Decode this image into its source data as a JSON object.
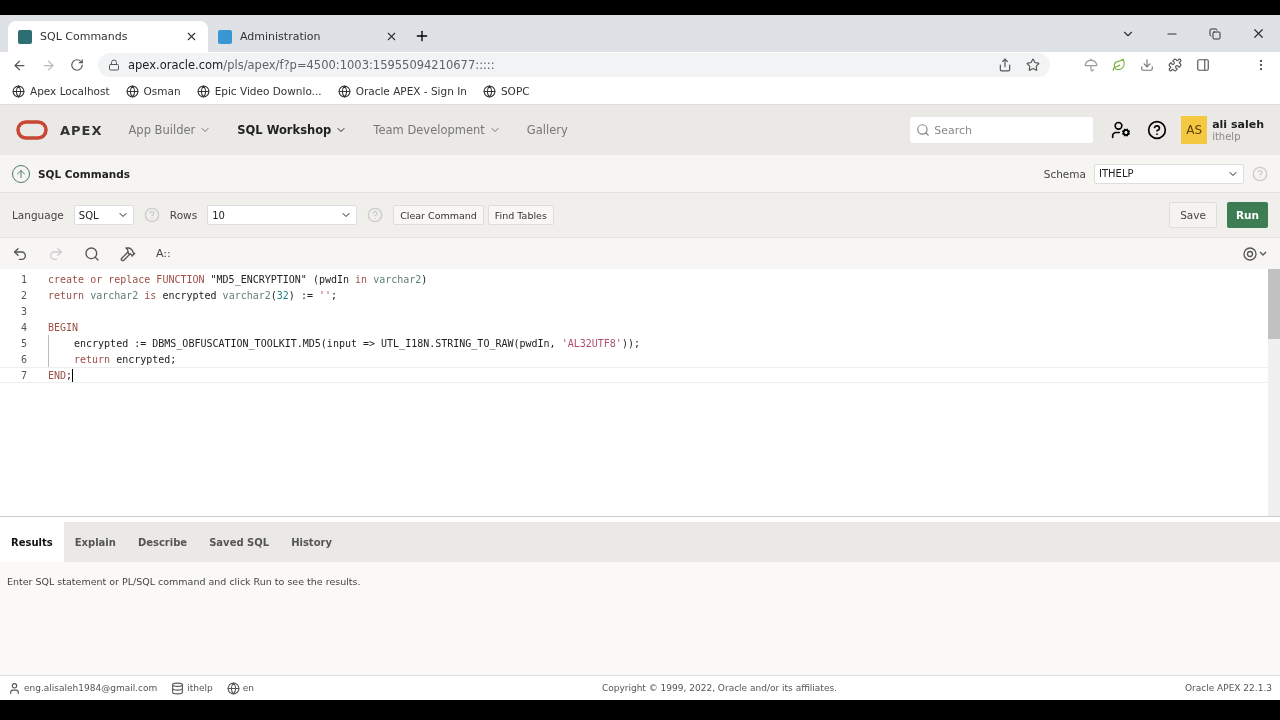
{
  "browser": {
    "tabs": [
      {
        "title": "SQL Commands",
        "selected": true,
        "kind": "apex"
      },
      {
        "title": "Administration",
        "selected": false,
        "kind": "admin"
      }
    ],
    "url": {
      "host": "apex.oracle.com",
      "path": "/pls/apex/f?p=4500:1003:15955094210677:::::"
    },
    "bookmarks": [
      "Apex Localhost",
      "Osman",
      "Epic Video Downlo...",
      "Oracle APEX - Sign In",
      "SOPC"
    ]
  },
  "header": {
    "logo": "APEX",
    "nav": [
      {
        "label": "App Builder",
        "selected": false,
        "menu": true
      },
      {
        "label": "SQL Workshop",
        "selected": true,
        "menu": true
      },
      {
        "label": "Team Development",
        "selected": false,
        "menu": true
      },
      {
        "label": "Gallery",
        "selected": false,
        "menu": false
      }
    ],
    "search": {
      "placeholder": "Search"
    },
    "user": {
      "initials": "AS",
      "name": "ali saleh",
      "workspace": "ithelp"
    }
  },
  "page": {
    "title": "SQL Commands",
    "schema_label": "Schema",
    "schema": "ITHELP"
  },
  "toolbar": {
    "language_label": "Language",
    "language": "SQL",
    "rows_label": "Rows",
    "rows": "10",
    "buttons": [
      "Clear Command",
      "Find Tables"
    ],
    "save": "Save",
    "run": "Run"
  },
  "editor": {
    "format_label": "A::",
    "lines": [
      {
        "number": "1",
        "indent": false,
        "cursor": false,
        "tokens": [
          {
            "t": "create or replace FUNCTION ",
            "kind": "keyword"
          },
          {
            "t": "\"MD5_ENCRYPTION\" (pwdIn ",
            "kind": "plain"
          },
          {
            "t": "in",
            "kind": "keyword"
          },
          {
            "t": " varchar2",
            "kind": "type"
          },
          {
            "t": ")",
            "kind": "plain"
          }
        ]
      },
      {
        "number": "2",
        "indent": false,
        "cursor": false,
        "tokens": [
          {
            "t": "return",
            "kind": "keyword"
          },
          {
            "t": " varchar2",
            "kind": "type"
          },
          {
            "t": " is",
            "kind": "keyword"
          },
          {
            "t": " encrypted ",
            "kind": "plain"
          },
          {
            "t": "varchar2",
            "kind": "type"
          },
          {
            "t": "(",
            "kind": "plain"
          },
          {
            "t": "32",
            "kind": "number"
          },
          {
            "t": ") := ",
            "kind": "plain"
          },
          {
            "t": "''",
            "kind": "string"
          },
          {
            "t": ";",
            "kind": "plain"
          }
        ]
      },
      {
        "number": "3",
        "indent": false,
        "cursor": false
      },
      {
        "number": "4",
        "indent": false,
        "cursor": false,
        "tokens": [
          {
            "t": "BEGIN",
            "kind": "keyword"
          }
        ]
      },
      {
        "number": "5",
        "indent": true,
        "cursor": false,
        "tokens": [
          {
            "t": "encrypted := DBMS_OBFUSCATION_TOOLKIT.MD5(input => UTL_I18N.STRING_TO_RAW(pwdIn, ",
            "kind": "plain"
          },
          {
            "t": "'AL32UTF8'",
            "kind": "string"
          },
          {
            "t": "));",
            "kind": "plain"
          }
        ]
      },
      {
        "number": "6",
        "indent": true,
        "cursor": false,
        "tokens": [
          {
            "t": "return",
            "kind": "keyword"
          },
          {
            "t": " encrypted;",
            "kind": "plain"
          }
        ]
      },
      {
        "number": "7",
        "indent": false,
        "cursor": true,
        "tokens": [
          {
            "t": "END",
            "kind": "keyword"
          },
          {
            "t": ";",
            "kind": "plain"
          }
        ]
      }
    ]
  },
  "results": {
    "tabs": [
      {
        "label": "Results",
        "selected": true
      },
      {
        "label": "Explain",
        "selected": false
      },
      {
        "label": "Describe",
        "selected": false
      },
      {
        "label": "Saved SQL",
        "selected": false
      },
      {
        "label": "History",
        "selected": false
      }
    ],
    "message": "Enter SQL statement or PL/SQL command and click Run to see the results."
  },
  "footer": {
    "email": "eng.alisaleh1984@gmail.com",
    "workspace": "ithelp",
    "language": "en",
    "copyright": "Copyright © 1999, 2022, Oracle and/or its affiliates.",
    "version": "Oracle APEX 22.1.3"
  }
}
